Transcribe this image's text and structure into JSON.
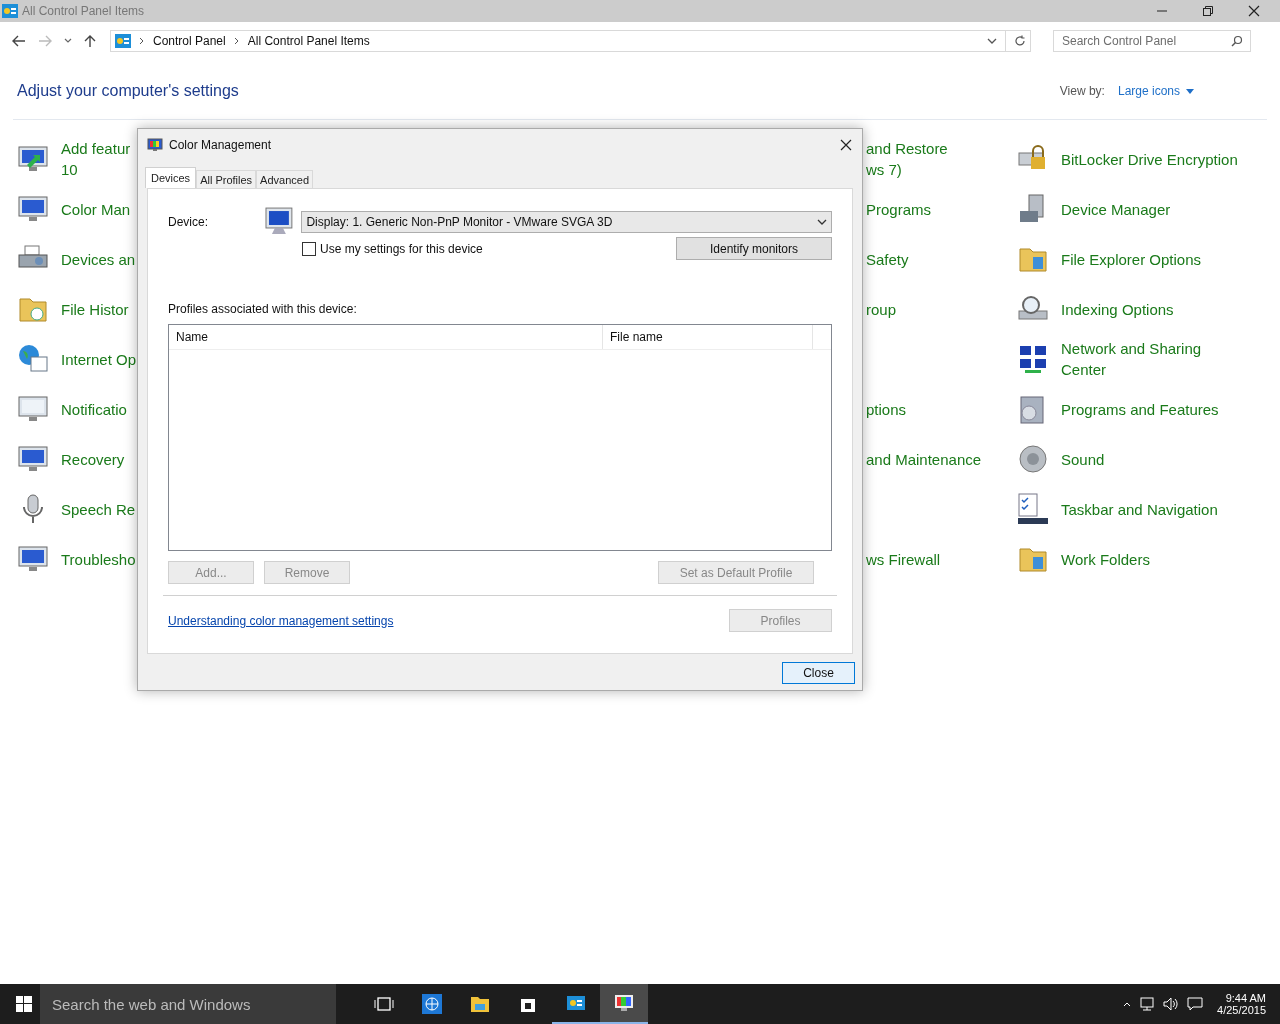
{
  "window": {
    "title": "All Control Panel Items"
  },
  "nav": {
    "breadcrumbs": [
      "Control Panel",
      "All Control Panel Items"
    ],
    "search": {
      "placeholder": "Search Control Panel"
    }
  },
  "header": {
    "title": "Adjust your computer's settings",
    "view_by_label": "View by:",
    "view_by_value": "Large icons"
  },
  "rows": [
    {
      "left": {
        "lines": [
          "Add featur",
          "10"
        ]
      },
      "middle": {
        "lines": [
          "and Restore",
          "ws 7)"
        ]
      },
      "right": {
        "lines": [
          "BitLocker Drive Encryption"
        ]
      }
    },
    {
      "left": {
        "lines": [
          "Color Man"
        ]
      },
      "middle": {
        "lines": [
          "Programs"
        ]
      },
      "right": {
        "lines": [
          "Device Manager"
        ]
      }
    },
    {
      "left": {
        "lines": [
          "Devices an"
        ]
      },
      "middle": {
        "lines": [
          "Safety"
        ]
      },
      "right": {
        "lines": [
          "File Explorer Options"
        ]
      }
    },
    {
      "left": {
        "lines": [
          "File Histor"
        ]
      },
      "middle": {
        "lines": [
          "roup"
        ]
      },
      "right": {
        "lines": [
          "Indexing Options"
        ]
      }
    },
    {
      "left": {
        "lines": [
          "Internet Op"
        ]
      },
      "right": {
        "lines": [
          "Network and Sharing",
          "Center"
        ]
      }
    },
    {
      "left": {
        "lines": [
          "Notificatio"
        ]
      },
      "middle": {
        "lines": [
          "ptions"
        ]
      },
      "right": {
        "lines": [
          "Programs and Features"
        ]
      }
    },
    {
      "left": {
        "lines": [
          "Recovery"
        ]
      },
      "middle": {
        "lines": [
          "and Maintenance"
        ]
      },
      "right": {
        "lines": [
          "Sound"
        ]
      }
    },
    {
      "left": {
        "lines": [
          "Speech Re"
        ]
      },
      "right": {
        "lines": [
          "Taskbar and Navigation"
        ]
      }
    },
    {
      "left": {
        "lines": [
          "Troublesho"
        ]
      },
      "middle": {
        "lines": [
          "ws Firewall"
        ]
      },
      "right": {
        "lines": [
          "Work Folders"
        ]
      }
    }
  ],
  "dialog": {
    "title": "Color Management",
    "tabs": [
      {
        "label": "Devices",
        "selected": true
      },
      {
        "label": "All Profiles",
        "selected": false
      },
      {
        "label": "Advanced",
        "selected": false
      }
    ],
    "device_label": "Device:",
    "device_value": "Display: 1. Generic Non-PnP Monitor - VMware SVGA 3D",
    "checkbox": {
      "label": "Use my settings for this device",
      "checked": false
    },
    "identify_button": "Identify monitors",
    "profiles_label": "Profiles associated with this device:",
    "columns": [
      "Name",
      "File name"
    ],
    "profile_buttons": [
      {
        "label": "Add...",
        "disabled": true
      },
      {
        "label": "Remove",
        "disabled": true
      },
      {
        "label": "Set as Default Profile",
        "disabled": true
      }
    ],
    "link": "Understanding color management settings",
    "profiles_button": {
      "label": "Profiles",
      "disabled": true
    },
    "close_button": "Close"
  },
  "taskbar": {
    "search": {
      "placeholder": "Search the web and Windows"
    },
    "apps": [
      {
        "selected": false,
        "running": false
      },
      {
        "selected": false,
        "running": false
      },
      {
        "selected": false,
        "running": false
      },
      {
        "selected": false,
        "running": false
      },
      {
        "selected": false,
        "running": true
      },
      {
        "selected": true,
        "running": true
      }
    ],
    "time": "9:44 AM",
    "date": "4/25/2015"
  }
}
